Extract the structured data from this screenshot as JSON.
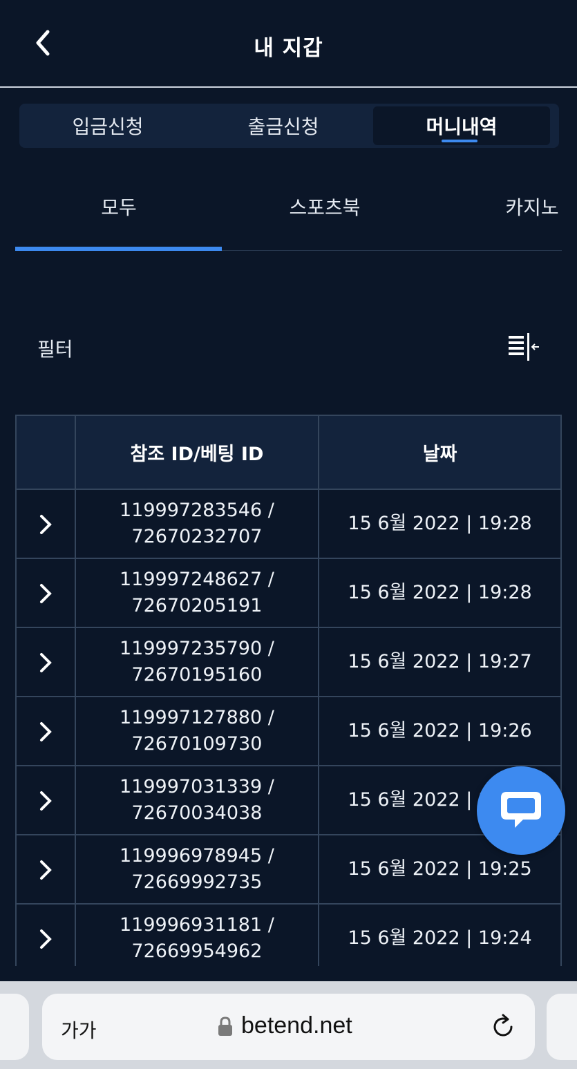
{
  "header": {
    "title": "내 지갑",
    "back_icon": "chevron-left-icon"
  },
  "wallet_tabs": [
    {
      "label": "입금신청",
      "active": false
    },
    {
      "label": "출금신청",
      "active": false
    },
    {
      "label": "머니내역",
      "active": true
    }
  ],
  "sub_tabs": [
    {
      "label": "모두",
      "active": true
    },
    {
      "label": "스포츠북",
      "active": false
    },
    {
      "label": "카지노",
      "active": false
    }
  ],
  "filter": {
    "label": "필터",
    "icon": "filter-collapse-icon"
  },
  "table": {
    "headers": [
      "",
      "참조 ID/베팅 ID",
      "날짜"
    ],
    "rows": [
      {
        "ref": "119997283546 /",
        "bet": "72670232707",
        "date": "15 6월 2022 | 19:28"
      },
      {
        "ref": "119997248627 /",
        "bet": "72670205191",
        "date": "15 6월 2022 | 19:28"
      },
      {
        "ref": "119997235790 /",
        "bet": "72670195160",
        "date": "15 6월 2022 | 19:27"
      },
      {
        "ref": "119997127880 /",
        "bet": "72670109730",
        "date": "15 6월 2022 | 19:26"
      },
      {
        "ref": "119997031339 /",
        "bet": "72670034038",
        "date": "15 6월 2022 | 19:26"
      },
      {
        "ref": "119996978945 /",
        "bet": "72669992735",
        "date": "15 6월 2022 | 19:25"
      },
      {
        "ref": "119996931181 /",
        "bet": "72669954962",
        "date": "15 6월 2022 | 19:24"
      }
    ]
  },
  "chat": {
    "icon": "chat-bubble-icon"
  },
  "browser": {
    "text_size": "가가",
    "url": "betend.net"
  },
  "colors": {
    "background": "#0b1628",
    "accent": "#3d8af0",
    "panel": "#13233c"
  }
}
